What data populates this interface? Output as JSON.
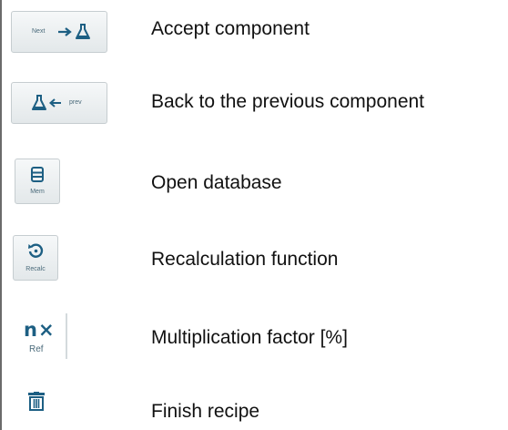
{
  "rows": [
    {
      "icon": "next-flask-icon",
      "button_label": "Next",
      "description": "Accept component"
    },
    {
      "icon": "prev-flask-icon",
      "button_label": "prev",
      "description": "Back to the previous component"
    },
    {
      "icon": "database-icon",
      "button_label": "Mem",
      "description": "Open database"
    },
    {
      "icon": "recalc-icon",
      "button_label": "Recalc",
      "description": "Recalculation function"
    },
    {
      "icon": "multiply-icon",
      "button_label": "Ref",
      "button_glyph": "n×",
      "description": "Multiplication factor [%]"
    },
    {
      "icon": "trash-icon",
      "description": "Finish recipe"
    }
  ],
  "colors": {
    "accent": "#1d5f83",
    "button_bg": "#eef1f2",
    "button_border": "#c6cdd0"
  }
}
